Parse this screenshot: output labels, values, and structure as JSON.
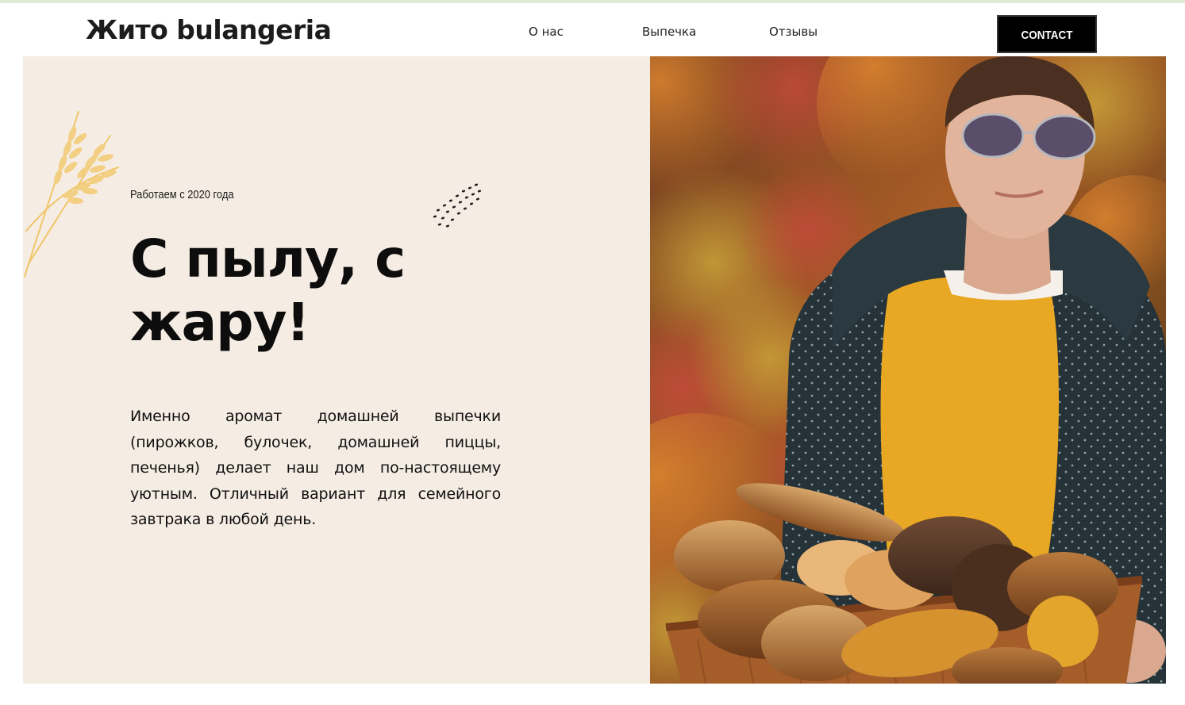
{
  "header": {
    "logo": "Жито bulangeria",
    "nav": [
      "О нас",
      "Выпечка",
      "Отзывы"
    ],
    "contact_label": "CONTACT"
  },
  "hero": {
    "since": "Работаем с 2020 года",
    "headline": "С пылу, с жару!",
    "description": "Именно аромат домашней выпечки (пирожков, булочек, домашней пиццы, печенья) делает наш дом по-настоящему уютным. Отличный вариант для семейного завтрака в любой день.",
    "photo_subject": "woman in yellow sweater holding a basket of fresh bread in autumn foliage"
  },
  "colors": {
    "hero_bg": "#f5ece3",
    "accent_line": "#dcecd6",
    "button_bg": "#000000",
    "sweater": "#e9a823"
  }
}
